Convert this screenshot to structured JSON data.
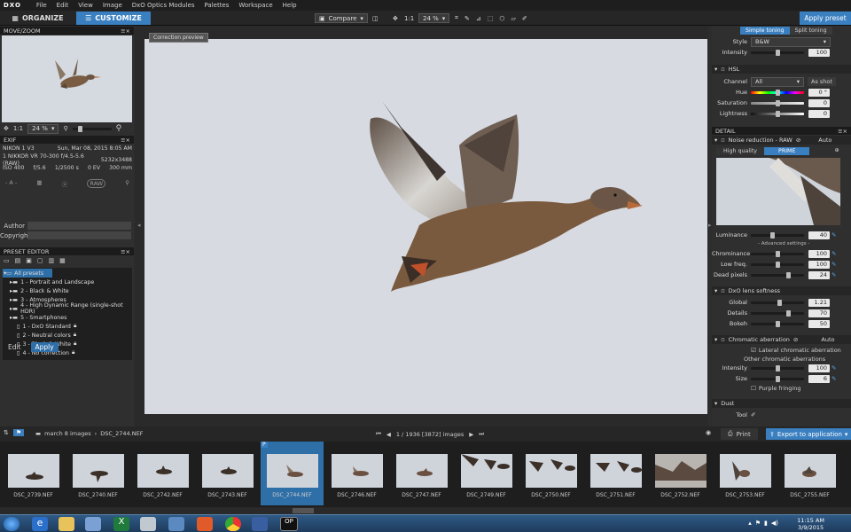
{
  "menu": {
    "logo": "DXO",
    "items": [
      "File",
      "Edit",
      "View",
      "Image",
      "DxO Optics Modules",
      "Palettes",
      "Workspace",
      "Help"
    ]
  },
  "toolbar": {
    "organize": "ORGANIZE",
    "customize": "CUSTOMIZE",
    "compare": "Compare",
    "ratio": "1:1",
    "zoom": "24 %",
    "apply_preset": "Apply preset"
  },
  "left": {
    "movezoom_title": "MOVE/ZOOM",
    "zoom_ratio": "1:1",
    "zoom_value": "24 %",
    "exif_title": "EXIF",
    "exif": {
      "camera": "NIKON 1 V3",
      "date": "Sun, Mar 08, 2015 8:05 AM",
      "lens": "1 NIKKOR VR 70-300 f/4.5-5.6 (RAW)",
      "dims": "5232x3488",
      "iso": "ISO 400",
      "aperture": "f/5.6",
      "shutter": "1/2500 s",
      "ev": "0 EV",
      "focal": "300 mm",
      "mode": "- A -",
      "raw": "RAW"
    },
    "author_label": "Author",
    "copyright_label": "Copyright",
    "preset_title": "PRESET EDITOR",
    "presets": [
      "All presets",
      "1 - Portrait and Landscape",
      "2 - Black & White",
      "3 - Atmospheres",
      "4 - High Dynamic Range (single-shot HDR)",
      "5 - Smartphones",
      "1 - DxO Standard",
      "2 - Neutral colors",
      "3 - Black & White",
      "4 - No correction"
    ],
    "edit": "Edit",
    "apply": "Apply"
  },
  "viewer": {
    "tooltip": "Correction preview"
  },
  "right": {
    "simple_toning": "Simple toning",
    "split_toning": "Split toning",
    "style_label": "Style",
    "style_value": "B&W",
    "intensity_label": "Intensity",
    "intensity_value": "100",
    "hsl_title": "HSL",
    "channel_label": "Channel",
    "channel_value": "All",
    "as_shot": "As shot",
    "hue_label": "Hue",
    "hue_value": "0 °",
    "saturation_label": "Saturation",
    "saturation_value": "0",
    "lightness_label": "Lightness",
    "lightness_value": "0",
    "detail_title": "DETAIL",
    "noise_title": "Noise reduction - RAW",
    "auto": "Auto",
    "hq": "High quality",
    "prime": "PRIME",
    "luminance_label": "Luminance",
    "luminance_value": "40",
    "advanced": "- Advanced settings -",
    "chrominance_label": "Chrominance",
    "chrominance_value": "100",
    "lowfreq_label": "Low freq.",
    "lowfreq_value": "100",
    "dead_label": "Dead pixels",
    "dead_value": "24",
    "lens_title": "DxO lens softness",
    "global_label": "Global",
    "global_value": "1.21",
    "details_label": "Details",
    "details_value": "70",
    "bokeh_label": "Bokeh",
    "bokeh_value": "50",
    "ca_title": "Chromatic aberration",
    "ca_auto": "Auto",
    "lateral": "Lateral chromatic aberration",
    "other_ca": "Other chromatic aberrations",
    "ca_intensity_label": "Intensity",
    "ca_intensity_value": "100",
    "size_label": "Size",
    "size_value": "6",
    "purple": "Purple fringing",
    "dust_title": "Dust",
    "tool_label": "Tool"
  },
  "filmbar": {
    "folder": "march 8 images",
    "file": "DSC_2744.NEF",
    "counter": "1 / 1936 [3872] images",
    "print": "Print",
    "export": "Export to application"
  },
  "thumbs": [
    "DSC_2739.NEF",
    "DSC_2740.NEF",
    "DSC_2742.NEF",
    "DSC_2743.NEF",
    "DSC_2744.NEF",
    "DSC_2746.NEF",
    "DSC_2747.NEF",
    "DSC_2749.NEF",
    "DSC_2750.NEF",
    "DSC_2751.NEF",
    "DSC_2752.NEF",
    "DSC_2753.NEF",
    "DSC_2755.NEF"
  ],
  "thumb_badge": "P",
  "taskbar": {
    "time": "11:15 AM",
    "date": "3/9/2015"
  },
  "colors": {
    "accent": "#3a7fc0",
    "selected": "#2f6fa8"
  }
}
